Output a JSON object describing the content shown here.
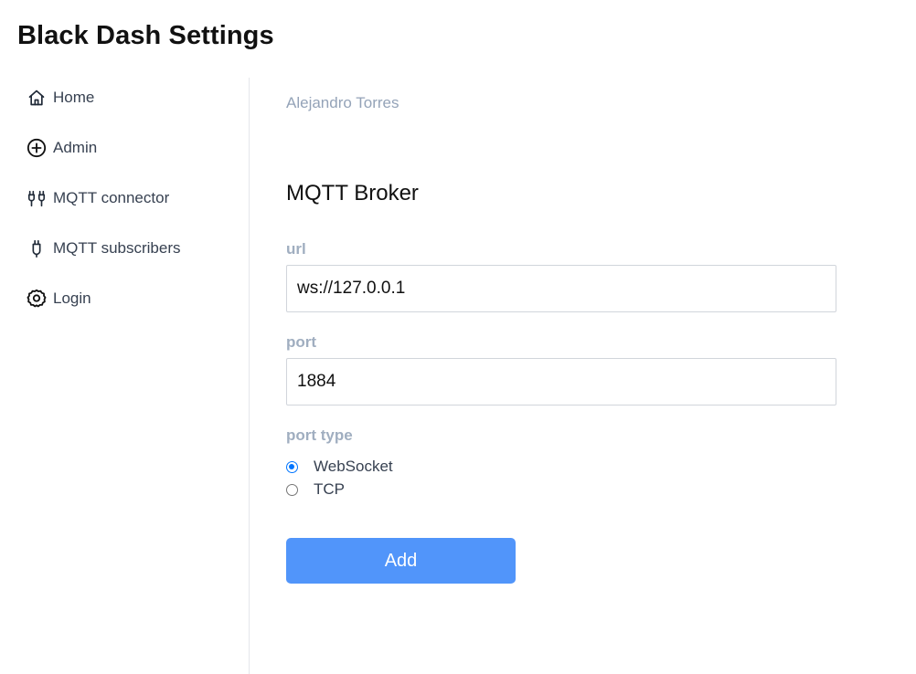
{
  "app": {
    "title": "Black Dash Settings"
  },
  "sidebar": {
    "items": [
      {
        "label": "Home",
        "icon": "home-icon"
      },
      {
        "label": "Admin",
        "icon": "plus-circle-icon"
      },
      {
        "label": "MQTT connector",
        "icon": "plug-connector-icon"
      },
      {
        "label": "MQTT subscribers",
        "icon": "plug-icon"
      },
      {
        "label": "Login",
        "icon": "gear-icon"
      }
    ]
  },
  "main": {
    "user_name": "Alejandro Torres",
    "section_title": "MQTT Broker",
    "url": {
      "label": "url",
      "value": "ws://127.0.0.1"
    },
    "port": {
      "label": "port",
      "value": "1884"
    },
    "port_type": {
      "label": "port type",
      "options": [
        {
          "label": "WebSocket",
          "checked": true
        },
        {
          "label": "TCP",
          "checked": false
        }
      ]
    },
    "add_button_label": "Add"
  },
  "colors": {
    "accent": "#5195fa",
    "radio_checked": "#0075ff",
    "muted_label": "#a0aec0",
    "divider": "#e5e7eb"
  }
}
